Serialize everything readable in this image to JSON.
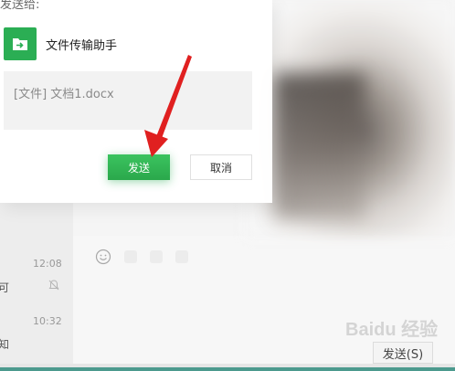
{
  "dialog": {
    "send_to_label": "发送给:",
    "recipient_name": "文件传输助手",
    "preview_text": "[文件] 文档1.docx",
    "send_button": "发送",
    "cancel_button": "取消"
  },
  "chat_list": [
    {
      "time": "12:08",
      "snippet": "可"
    },
    {
      "time": "10:32",
      "snippet": "知"
    }
  ],
  "input_area": {
    "send_button": "发送(S)"
  },
  "watermark": "Baidu 经验",
  "colors": {
    "accent": "#2bae54",
    "arrow": "#e02020",
    "bottom_bar": "#4c9a8e"
  }
}
